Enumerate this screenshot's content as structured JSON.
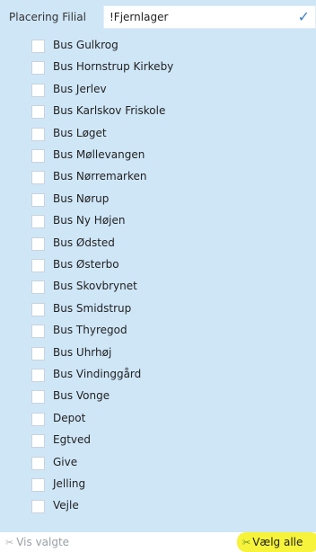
{
  "header": {
    "label": "Placering Filial",
    "filter_value": "!Fjernlager",
    "confirm_icon": "check-icon"
  },
  "list": {
    "items": [
      {
        "label": "Bus Gulkrog",
        "checked": false
      },
      {
        "label": "Bus Hornstrup Kirkeby",
        "checked": false
      },
      {
        "label": "Bus Jerlev",
        "checked": false
      },
      {
        "label": "Bus Karlskov Friskole",
        "checked": false
      },
      {
        "label": "Bus Løget",
        "checked": false
      },
      {
        "label": "Bus Møllevangen",
        "checked": false
      },
      {
        "label": "Bus Nørremarken",
        "checked": false
      },
      {
        "label": "Bus Nørup",
        "checked": false
      },
      {
        "label": "Bus Ny Højen",
        "checked": false
      },
      {
        "label": "Bus Ødsted",
        "checked": false
      },
      {
        "label": "Bus Østerbo",
        "checked": false
      },
      {
        "label": "Bus Skovbrynet",
        "checked": false
      },
      {
        "label": "Bus Smidstrup",
        "checked": false
      },
      {
        "label": "Bus Thyregod",
        "checked": false
      },
      {
        "label": "Bus Uhrhøj",
        "checked": false
      },
      {
        "label": "Bus Vindinggård",
        "checked": false
      },
      {
        "label": "Bus Vonge",
        "checked": false
      },
      {
        "label": "Depot",
        "checked": false
      },
      {
        "label": "Egtved",
        "checked": false
      },
      {
        "label": "Give",
        "checked": false
      },
      {
        "label": "Jelling",
        "checked": false
      },
      {
        "label": "Vejle",
        "checked": false
      }
    ]
  },
  "footer": {
    "vis_valgte_label": "Vis valgte",
    "vis_valgte_icon": "show-selected-icon",
    "vaelg_alle_label": "Vælg alle",
    "vaelg_alle_icon": "select-all-icon",
    "highlight_color": "#f6f33a"
  },
  "colors": {
    "panel_background": "#cfe6f7",
    "checkbox_border": "#c9d3dc",
    "check_icon": "#3c7fc6"
  }
}
